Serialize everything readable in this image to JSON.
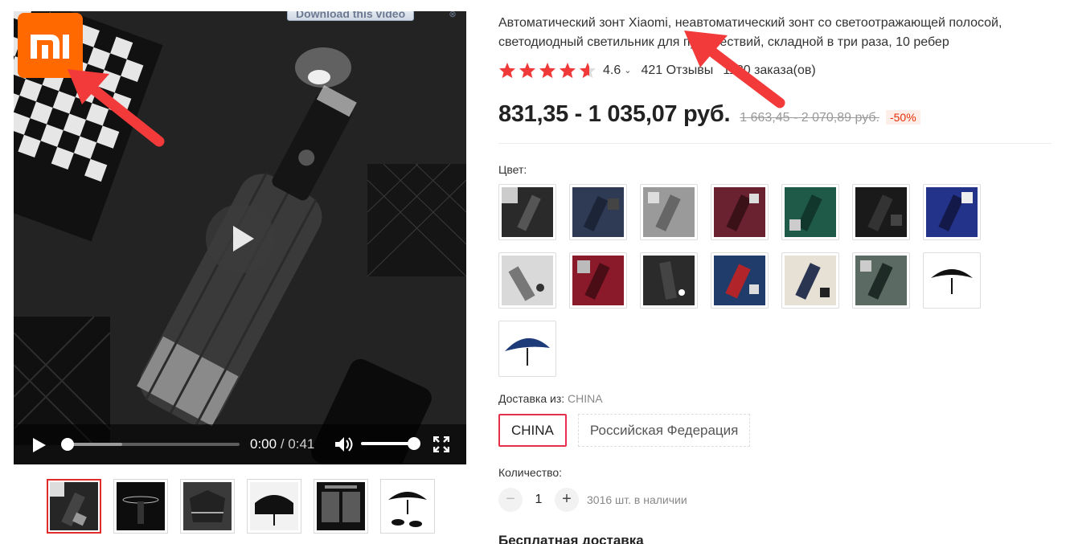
{
  "video": {
    "download_label": "Download this video",
    "download_close": "⊗",
    "logo_text": "MI",
    "time_current": "0:00",
    "time_separator": " / ",
    "time_duration": "0:41",
    "progress": 0.0,
    "volume": 1.0
  },
  "thumbnails": [
    {
      "name": "thumb-1",
      "active": true
    },
    {
      "name": "thumb-2",
      "active": false
    },
    {
      "name": "thumb-3",
      "active": false
    },
    {
      "name": "thumb-4",
      "active": false
    },
    {
      "name": "thumb-5",
      "active": false
    },
    {
      "name": "thumb-6",
      "active": false
    }
  ],
  "product": {
    "title": "Автоматический зонт Xiaomi, неавтоматический зонт со светоотражающей полосой, светодиодный светильник для путешествий, складной в три раза, 10 ребер",
    "rating": "4.6",
    "rating_stars": 4.6,
    "reviews": "421 Отзывы",
    "orders": "1180 заказа(ов)",
    "price": "831,35 - 1 035,07 руб.",
    "old_price": "1 663,45 - 2 070,89 руб.",
    "discount": "-50%"
  },
  "color": {
    "label": "Цвет:",
    "swatches": [
      "dark-1",
      "navy",
      "grey",
      "burgundy",
      "green",
      "black",
      "blue",
      "light-grey",
      "red",
      "dark-2",
      "red-blue",
      "beige",
      "open-black",
      "open-navy"
    ]
  },
  "shipping": {
    "label": "Доставка из:",
    "value": "CHINA",
    "options": [
      "CHINA",
      "Российская Федерация"
    ],
    "selected": "CHINA"
  },
  "quantity": {
    "label": "Количество:",
    "value": "1",
    "minus": "−",
    "plus": "+",
    "stock": "3016 шт. в наличии"
  },
  "free_shipping": "Бесплатная доставка",
  "colors": {
    "accent": "#e62e4d",
    "price_red": "#e62e04",
    "star": "#f03a3a",
    "logo": "#ff6900"
  }
}
